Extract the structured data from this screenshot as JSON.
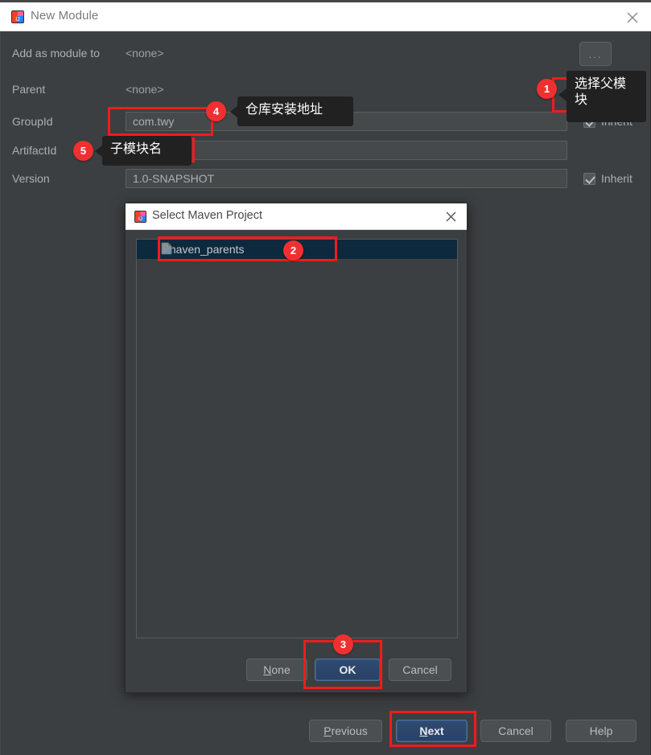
{
  "window": {
    "title": "New Module",
    "icon": "intellij-icon",
    "close_label": "✕"
  },
  "form": {
    "rows": [
      {
        "label": "Add as module to",
        "value": "<none>"
      },
      {
        "label": "Parent",
        "value": "<none>"
      },
      {
        "label": "GroupId",
        "value": "com.twy"
      },
      {
        "label": "ArtifactId",
        "value": ""
      },
      {
        "label": "Version",
        "value": "1.0-SNAPSHOT"
      }
    ],
    "browse_button_label": "...",
    "inherit_label": "Inherit"
  },
  "maven_dialog": {
    "title": "Select Maven Project",
    "icon": "intellij-icon",
    "close_label": "✕",
    "items": [
      {
        "label": "maven_parents",
        "icon": "maven-module-icon",
        "selected": true
      }
    ],
    "buttons": {
      "none": "None",
      "none_mnemonic": "N",
      "ok": "OK",
      "cancel": "Cancel"
    }
  },
  "wizard_buttons": {
    "previous": "Previous",
    "previous_mnemonic": "P",
    "next": "Next",
    "next_mnemonic": "N",
    "cancel": "Cancel",
    "help": "Help"
  },
  "annotations": {
    "badges": [
      {
        "id": "1",
        "text": "1"
      },
      {
        "id": "2",
        "text": "2"
      },
      {
        "id": "3",
        "text": "3"
      },
      {
        "id": "4",
        "text": "4"
      },
      {
        "id": "5",
        "text": "5"
      }
    ],
    "tooltips": [
      {
        "id": "select-parent-module",
        "text": "选择父模块"
      },
      {
        "id": "repo-install-address",
        "text": "仓库安装地址"
      },
      {
        "id": "sub-module-name",
        "text": "子模块名"
      }
    ]
  },
  "colors": {
    "annotation_red": "#ef1c1c",
    "badge_red": "#f03030",
    "tooltip_bg": "#212121",
    "dialog_bg": "#3c3f41",
    "selection_blue": "#0d293e",
    "primary_button": "#2f4b70"
  }
}
